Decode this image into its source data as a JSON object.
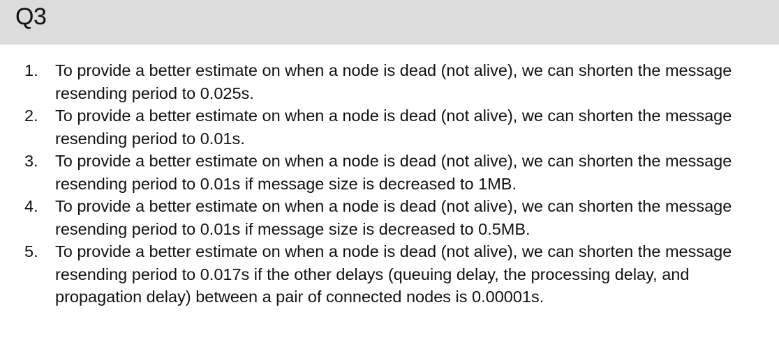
{
  "header": {
    "title": "Q3"
  },
  "answers": [
    {
      "number": "1.",
      "text": "To provide a better estimate on when a node is dead (not alive), we can shorten the message resending period to 0.025s."
    },
    {
      "number": "2.",
      "text": "To provide a better estimate on when a node is dead (not alive), we can shorten the message resending period to 0.01s."
    },
    {
      "number": "3.",
      "text": "To provide a better estimate on when a node is dead (not alive), we can shorten the message resending period to 0.01s if message size is decreased to 1MB."
    },
    {
      "number": "4.",
      "text": "To provide a better estimate on when a node is dead (not alive), we can shorten the message resending period to 0.01s if message size is decreased to 0.5MB."
    },
    {
      "number": "5.",
      "text": "To provide a better estimate on when a node is dead (not alive), we can shorten the message resending period to 0.017s if the other delays (queuing delay, the processing delay, and propagation delay) between a pair of connected nodes is 0.00001s."
    }
  ]
}
